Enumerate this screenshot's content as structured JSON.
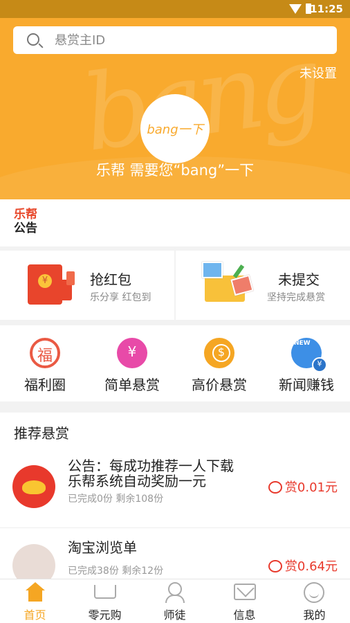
{
  "status_bar": {
    "time": "11:25"
  },
  "header": {
    "search_placeholder": "悬赏主ID",
    "setting_label": "未设置",
    "logo_text": "bang一下",
    "watermark": "bang",
    "slogan": "乐帮 需要您“bang”一下",
    "background_color": "#f9aa2e"
  },
  "notice": {
    "line1": "乐帮",
    "line2": "公告"
  },
  "promos": [
    {
      "title": "抢红包",
      "subtitle": "乐分享 红包到"
    },
    {
      "title": "未提交",
      "subtitle": "坚持完成悬赏"
    }
  ],
  "categories": [
    {
      "label": "福利圈",
      "icon": "fu-icon"
    },
    {
      "label": "简单悬赏",
      "icon": "money-bag-icon"
    },
    {
      "label": "高价悬赏",
      "icon": "coin-stack-icon"
    },
    {
      "label": "新闻赚钱",
      "icon": "news-icon"
    }
  ],
  "recommended": {
    "heading": "推荐悬赏",
    "tasks": [
      {
        "title": "公告：每成功推荐一人下载乐帮系统自动奖励一元",
        "meta": "已完成0份 剩余108份",
        "reward": "赏0.01元"
      },
      {
        "title": "淘宝浏览单",
        "meta": "已完成38份 剩余12份",
        "reward": "赏0.64元"
      }
    ]
  },
  "tabs": [
    {
      "label": "首页",
      "icon": "home-icon",
      "active": true
    },
    {
      "label": "零元购",
      "icon": "cart-icon"
    },
    {
      "label": "师徒",
      "icon": "users-icon"
    },
    {
      "label": "信息",
      "icon": "mail-icon"
    },
    {
      "label": "我的",
      "icon": "profile-icon"
    }
  ],
  "colors": {
    "accent": "#f5a623",
    "reward": "#e8392c"
  }
}
